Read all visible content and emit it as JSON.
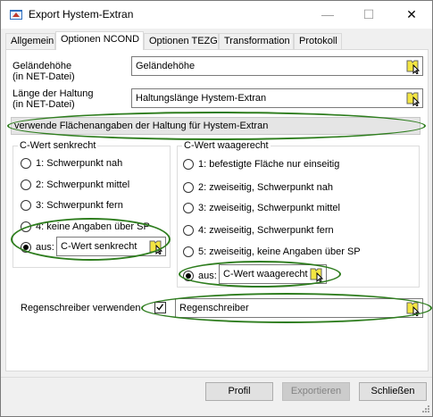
{
  "window": {
    "title": "Export Hystem-Extran",
    "minimize": "—",
    "maximize": "☐",
    "close": "✕"
  },
  "tabs": [
    "Allgemein",
    "Optionen NCOND",
    "Optionen TEZG",
    "Transformation",
    "Protokoll"
  ],
  "fields": {
    "gelaende": {
      "label_line1": "Geländehöhe",
      "label_line2": "(in NET-Datei)",
      "value": "Geländehöhe"
    },
    "laenge": {
      "label_line1": "Länge der Haltung",
      "label_line2": "(in NET-Datei)",
      "value": "Haltungslänge Hystem-Extran"
    }
  },
  "section_bar": "verwende Flächenangaben der Haltung für Hystem-Extran",
  "cwert_senkrecht": {
    "title": "C-Wert senkrecht",
    "options": [
      "1: Schwerpunkt nah",
      "2: Schwerpunkt mittel",
      "3: Schwerpunkt fern",
      "4: keine Angaben über SP"
    ],
    "aus_label": "aus:",
    "aus_value": "C-Wert senkrecht"
  },
  "cwert_waagerecht": {
    "title": "C-Wert waagerecht",
    "options": [
      "1: befestigte Fläche nur einseitig",
      "2: zweiseitig, Schwerpunkt nah",
      "3: zweiseitig, Schwerpunkt mittel",
      "4: zweiseitig, Schwerpunkt fern",
      "5: zweiseitig, keine Angaben über SP"
    ],
    "aus_label": "aus:",
    "aus_value": "C-Wert waagerecht"
  },
  "regenschreiber": {
    "label": "Regenschreiber verwenden",
    "checked": true,
    "value": "Regenschreiber"
  },
  "buttons": {
    "profil": "Profil",
    "exportieren": "Exportieren",
    "schliessen": "Schließen"
  },
  "colors": {
    "highlight_oval": "#2e7d1e",
    "field_button_icon": "#f3e542"
  }
}
